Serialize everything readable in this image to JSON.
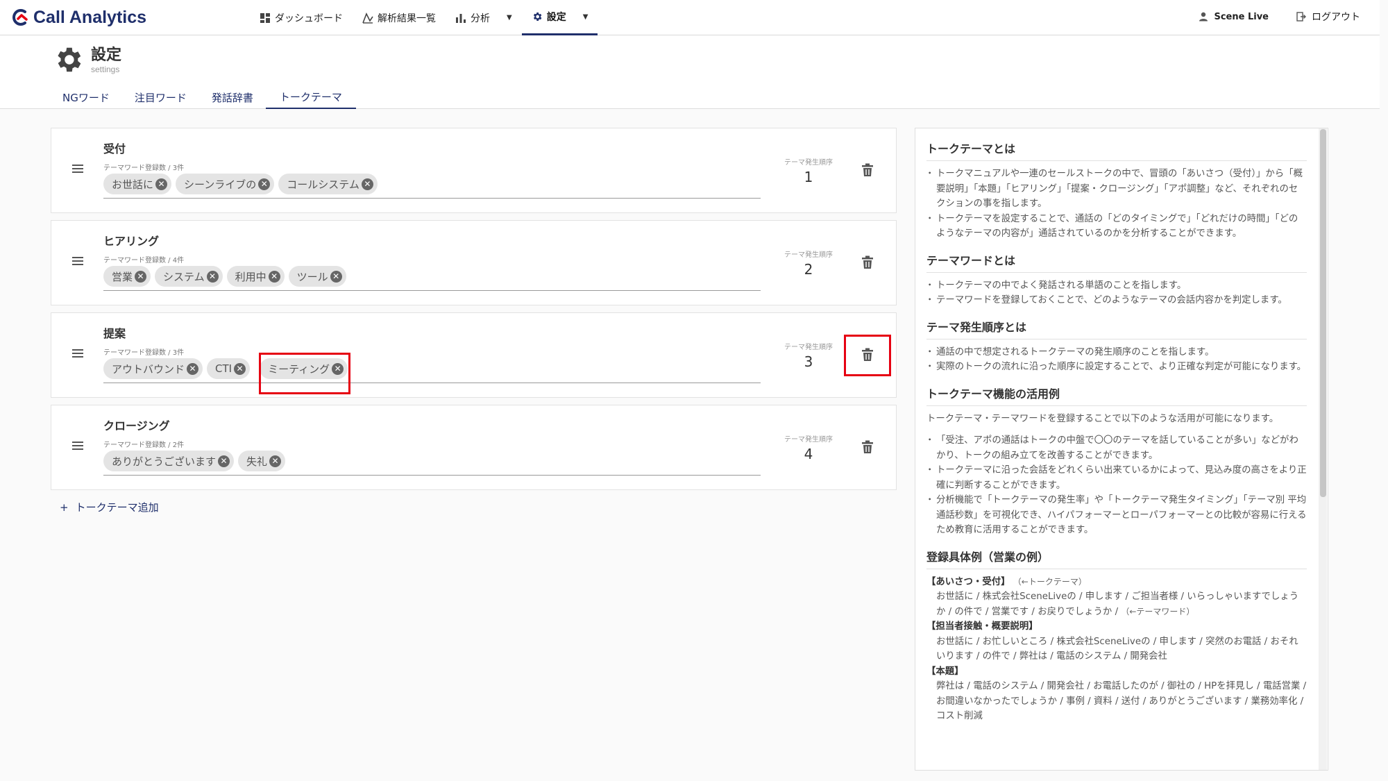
{
  "app": {
    "name": "Call Analytics",
    "brand_color": "#1f2f6b"
  },
  "nav": {
    "items": [
      {
        "label": "ダッシュボード",
        "icon": "dashboard-icon"
      },
      {
        "label": "解析結果一覧",
        "icon": "analysis-list-icon"
      },
      {
        "label": "分析",
        "icon": "bar-chart-icon"
      },
      {
        "label": "設定",
        "icon": "gear-icon"
      }
    ],
    "active": "設定",
    "user": "Scene Live",
    "logout": "ログアウト"
  },
  "page": {
    "title": "設定",
    "subtitle": "settings"
  },
  "tabs": [
    "NGワード",
    "注目ワード",
    "発話辞書",
    "トークテーマ"
  ],
  "active_tab": "トークテーマ",
  "themes": [
    {
      "title": "受付",
      "meta": "テーマワード登録数 / 3件",
      "order_label": "テーマ発生順序",
      "order": "1",
      "words": [
        "お世話に",
        "シーンライブの",
        "コールシステム"
      ]
    },
    {
      "title": "ヒアリング",
      "meta": "テーマワード登録数 / 4件",
      "order_label": "テーマ発生順序",
      "order": "2",
      "words": [
        "営業",
        "システム",
        "利用中",
        "ツール"
      ]
    },
    {
      "title": "提案",
      "meta": "テーマワード登録数 / 3件",
      "order_label": "テーマ発生順序",
      "order": "3",
      "words": [
        "アウトバウンド",
        "CTI",
        "ミーティング"
      ]
    },
    {
      "title": "クロージング",
      "meta": "テーマワード登録数 / 2件",
      "order_label": "テーマ発生順序",
      "order": "4",
      "words": [
        "ありがとうございます",
        "失礼"
      ]
    }
  ],
  "add_theme": {
    "icon": "+",
    "label": "トークテーマ追加"
  },
  "highlight_color": "#e60012",
  "info": {
    "s1": {
      "heading": "トークテーマとは",
      "items": [
        "トークマニュアルや一連のセールストークの中で、冒頭の「あいさつ（受付）」から「概要説明」「本題」「ヒアリング」「提案・クロージング」「アポ調整」など、それぞれのセクションの事を指します。",
        "トークテーマを設定することで、通話の「どのタイミングで」「どれだけの時間」「どのようなテーマの内容が」通話されているのかを分析することができます。"
      ]
    },
    "s2": {
      "heading": "テーマワードとは",
      "items": [
        "トークテーマの中でよく発話される単語のことを指します。",
        "テーマワードを登録しておくことで、どのようなテーマの会話内容かを判定します。"
      ]
    },
    "s3": {
      "heading": "テーマ発生順序とは",
      "items": [
        "通話の中で想定されるトークテーマの発生順序のことを指します。",
        "実際のトークの流れに沿った順序に設定することで、より正確な判定が可能になります。"
      ]
    },
    "s4": {
      "heading": "トークテーマ機能の活用例",
      "intro": "トークテーマ・テーマワードを登録することで以下のような活用が可能になります。",
      "items": [
        "「受注、アポの通話はトークの中盤で〇〇のテーマを話していることが多い」などがわかり、トークの組み立てを改善することができます。",
        "トークテーマに沿った会話をどれくらい出来ているかによって、見込み度の高さをより正確に判断することができます。",
        "分析機能で「トークテーマの発生率」や「トークテーマ発生タイミング」「テーマ別 平均通話秒数」を可視化でき、ハイパフォーマーとローパフォーマーとの比較が容易に行えるため教育に活用することができます。"
      ]
    },
    "s5": {
      "heading": "登録具体例（営業の例）",
      "ex1_h": "【あいさつ・受付】",
      "ex1_note": "（←トークテーマ）",
      "ex1_body": "お世話に / 株式会社SceneLiveの / 申します / ご担当者様 / いらっしゃいますでしょうか / の件で / 営業です / お戻りでしょうか /",
      "ex1_body_note": "（←テーマワード）",
      "ex2_h": "【担当者接触・概要説明】",
      "ex2_body": "お世話に / お忙しいところ / 株式会社SceneLiveの / 申します / 突然のお電話 / おそれいります / の件で / 弊社は / 電話のシステム / 開発会社",
      "ex3_h": "【本題】",
      "ex3_body": "弊社は / 電話のシステム / 開発会社 / お電話したのが / 御社の / HPを拝見し / 電話営業 / お間違いなかったでしょうか / 事例 / 資料 / 送付 / ありがとうございます / 業務効率化 / コスト削減"
    }
  }
}
